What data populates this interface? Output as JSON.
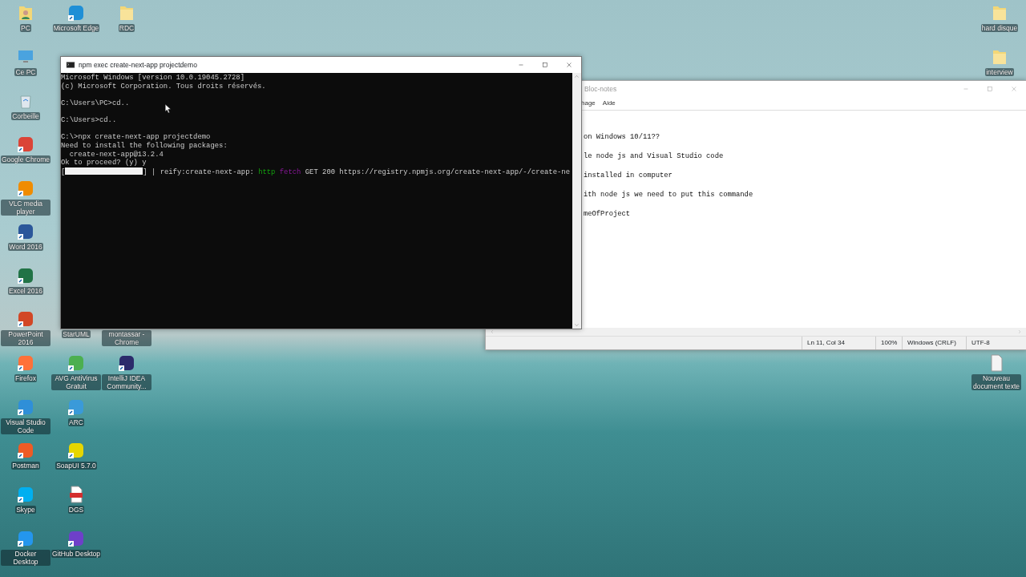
{
  "desktop_icons": [
    {
      "label": "PC",
      "kind": "user-folder"
    },
    {
      "label": "Ce PC",
      "kind": "monitor"
    },
    {
      "label": "Corbeille",
      "kind": "bin"
    },
    {
      "label": "Google Chrome",
      "kind": "app",
      "color": "#db4437"
    },
    {
      "label": "VLC media player",
      "kind": "app",
      "color": "#f08c00"
    },
    {
      "label": "Word 2016",
      "kind": "app",
      "color": "#2b579a"
    },
    {
      "label": "Excel 2016",
      "kind": "app",
      "color": "#217346"
    },
    {
      "label": "PowerPoint 2016",
      "kind": "app",
      "color": "#d24726"
    },
    {
      "label": "Firefox",
      "kind": "app",
      "color": "#ff7139"
    },
    {
      "label": "Visual Studio Code",
      "kind": "app",
      "color": "#2f8fd8"
    },
    {
      "label": "Postman",
      "kind": "app",
      "color": "#ef5b25"
    },
    {
      "label": "Skype",
      "kind": "app",
      "color": "#00aff0"
    },
    {
      "label": "Docker Desktop",
      "kind": "app",
      "color": "#2496ed"
    },
    {
      "label": "Microsoft Edge",
      "kind": "app",
      "color": "#1f8fd6"
    },
    {
      "label": "StarUML",
      "kind": "covered"
    },
    {
      "label": "AVG AntiVirus Gratuit",
      "kind": "app",
      "color": "#4caf50"
    },
    {
      "label": "ARC",
      "kind": "app",
      "color": "#3a9ad9"
    },
    {
      "label": "SoapUI 5.7.0",
      "kind": "app",
      "color": "#e6d600"
    },
    {
      "label": "DGS",
      "kind": "pdf"
    },
    {
      "label": "GitHub Desktop",
      "kind": "app",
      "color": "#6e40c9"
    },
    {
      "label": "RDC",
      "kind": "folder"
    },
    {
      "label": "montassar - Chrome",
      "kind": "covered"
    },
    {
      "label": "IntelliJ IDEA Community...",
      "kind": "app",
      "color": "#2b2b6b"
    },
    {
      "label": "hard disque",
      "kind": "folder"
    },
    {
      "label": "interview",
      "kind": "folder"
    },
    {
      "label": "Nouveau document texte",
      "kind": "document"
    }
  ],
  "notepad": {
    "title": "Bloc-notes",
    "menu": [
      "hage",
      "Aide"
    ],
    "lines": [
      "on Windows 10/11??",
      "le node js and Visual Studio code",
      "installed in computer",
      "ith node js we need to put this commande",
      "meOfProject"
    ],
    "status_bar": [
      "Ln 11, Col 34",
      "100%",
      "Windows (CRLF)",
      "UTF-8"
    ]
  },
  "terminal": {
    "title": "npm exec create-next-app projectdemo",
    "lines": [
      {
        "kind": "text",
        "text": "Microsoft Windows [version 10.0.19045.2728]"
      },
      {
        "kind": "text",
        "text": "(c) Microsoft Corporation. Tous droits réservés."
      },
      {
        "kind": "blank"
      },
      {
        "kind": "text",
        "text": "C:\\Users\\PC>cd.."
      },
      {
        "kind": "blank"
      },
      {
        "kind": "text",
        "text": "C:\\Users>cd.."
      },
      {
        "kind": "blank"
      },
      {
        "kind": "text",
        "text": "C:\\>npx create-next-app projectdemo"
      },
      {
        "kind": "text",
        "text": "Need to install the following packages:"
      },
      {
        "kind": "text",
        "text": "  create-next-app@13.2.4"
      },
      {
        "kind": "text",
        "text": "Ok to proceed? (y) y"
      },
      {
        "kind": "progress",
        "level": 1,
        "segments": [
          {
            "text": "[",
            "kind": "plain"
          },
          {
            "text": "] | reify:create-next-app:",
            "kind": "plain"
          },
          {
            "text": "http",
            "kind": "protocol"
          },
          {
            "text": "fetch",
            "kind": "verb"
          },
          {
            "text": "GET 200 https://registry.npmjs.org/create-next-app/-/create-ne",
            "kind": "plain"
          }
        ]
      }
    ]
  }
}
